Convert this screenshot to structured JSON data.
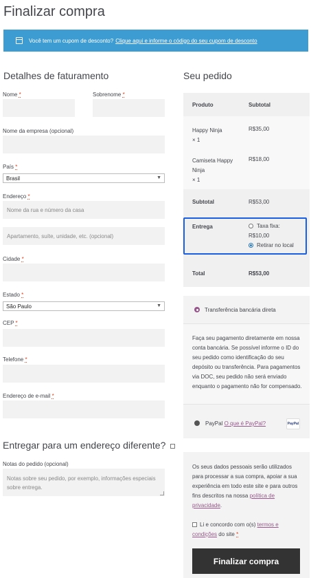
{
  "page_title": "Finalizar compra",
  "notice": {
    "text": "Você tem um cupom de desconto?",
    "link": "Clique aqui e informe o código do seu cupom de desconto"
  },
  "billing": {
    "heading": "Detalhes de faturamento",
    "first_name_label": "Nome",
    "last_name_label": "Sobrenome",
    "company_label": "Nome da empresa (opcional)",
    "country_label": "País",
    "country_value": "Brasil",
    "address_label": "Endereço",
    "address1_placeholder": "Nome da rua e número da casa",
    "address2_placeholder": "Apartamento, suíte, unidade, etc. (opcional)",
    "city_label": "Cidade",
    "state_label": "Estado",
    "state_value": "São Paulo",
    "postcode_label": "CEP",
    "phone_label": "Telefone",
    "email_label": "Endereço de e-mail",
    "required_mark": "*"
  },
  "shipping": {
    "heading": "Entregar para um endereço diferente?",
    "notes_label": "Notas do pedido (opcional)",
    "notes_placeholder": "Notas sobre seu pedido, por exemplo, informações especiais sobre entrega."
  },
  "order": {
    "heading": "Seu pedido",
    "col_product": "Produto",
    "col_subtotal": "Subtotal",
    "items": [
      {
        "name": "Happy Ninja",
        "qty": "× 1",
        "price": "R$35,00"
      },
      {
        "name": "Camiseta Happy Ninja",
        "qty": "× 1",
        "price": "R$18,00"
      }
    ],
    "subtotal_label": "Subtotal",
    "subtotal_value": "R$53,00",
    "shipping_label": "Entrega",
    "shipping_option1": "Taxa fixa:",
    "shipping_option1_price": "R$10,00",
    "shipping_option2": "Retirar no local",
    "total_label": "Total",
    "total_value": "R$53,00"
  },
  "payment": {
    "bacs_label": "Transferência bancária direta",
    "bacs_desc": "Faça seu pagamento diretamente em nossa conta bancária. Se possível informe o ID do seu pedido como identificação do seu depósito ou transferência. Para pagamentos via DOC, seu pedido não será enviado enquanto o pagamento não for compensado.",
    "paypal_label": "PayPal",
    "paypal_link": "O que é PayPal?",
    "paypal_logo": "PayPal"
  },
  "privacy": {
    "text": "Os seus dados pessoais serão utilizados para processar a sua compra, apoiar a sua experiência em todo este site e para outros fins descritos na nossa",
    "link": "política de privacidade",
    "end": "."
  },
  "terms": {
    "text_before": "Li e concordo com o(s)",
    "link": "termos e condições",
    "text_after": "do site",
    "required_mark": "*"
  },
  "place_order_label": "Finalizar compra",
  "colors": {
    "notice": "#3d9cd2",
    "accent": "#96588a",
    "highlight": "#1a5ee6",
    "button": "#333333"
  }
}
